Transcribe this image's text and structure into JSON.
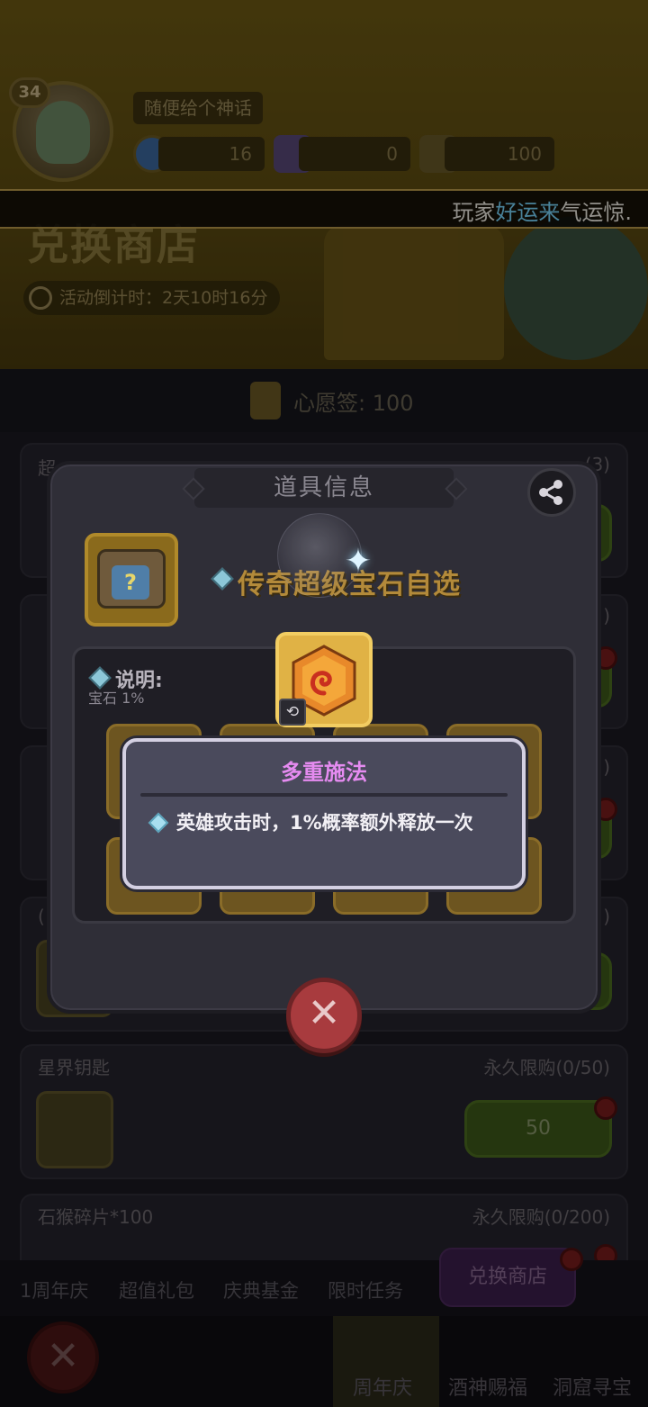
{
  "player": {
    "level": "34",
    "name": "随便给个神话"
  },
  "resources": [
    {
      "icon": "blue-coin-icon",
      "value": "16"
    },
    {
      "icon": "purple-scroll-icon",
      "value": "0"
    },
    {
      "icon": "wish-tag-icon",
      "value": "100"
    }
  ],
  "banner": {
    "before": "玩家",
    "highlight": "好运来",
    "after": "气运惊."
  },
  "shop": {
    "title": "兑换商店",
    "countdown": "活动倒计时：2天10时16分"
  },
  "wish": {
    "label": "心愿签: 100"
  },
  "cards": [
    {
      "title": "超",
      "limit": "(3)"
    },
    {
      "title": "",
      "limit": ")"
    },
    {
      "title": "",
      "limit": ")"
    },
    {
      "title": "(",
      "limit": ")"
    },
    {
      "title": "星界钥匙",
      "limit": "永久限购(0/50)",
      "price": "50"
    },
    {
      "title": "石猴碎片*100",
      "limit": "永久限购(0/200)"
    }
  ],
  "tabs": [
    "1周年庆",
    "超值礼包",
    "庆典基金",
    "限时任务"
  ],
  "active_tab": "兑换商店",
  "bottom_nav": [
    "周年庆",
    "酒神赐福",
    "洞窟寻宝"
  ],
  "dialog": {
    "title": "道具信息",
    "item_name": "传奇超级宝石自选",
    "desc_label": "说明:",
    "desc_fragment": "宝石 1%",
    "gem_badge": "⟲"
  },
  "tooltip": {
    "title": "多重施法",
    "text": "英雄攻击时，1%概率额外释放一次"
  },
  "colors": {
    "tooltip_title": "#e58bf0",
    "banner_highlight": "#7ad7ff",
    "item_name": "#b38a3a"
  }
}
